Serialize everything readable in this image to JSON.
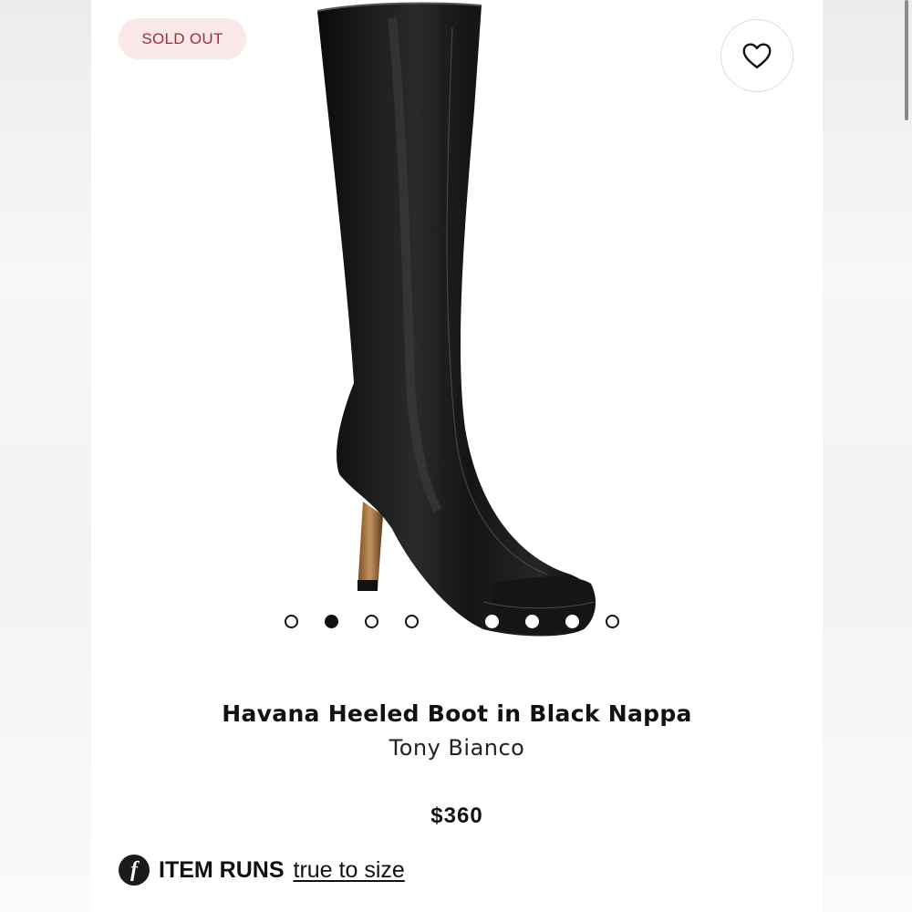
{
  "badge": {
    "label": "SOLD OUT"
  },
  "favorite": {
    "icon": "heart-icon"
  },
  "product": {
    "image_icon": "black-knee-high-boot-image",
    "title": "Havana Heeled Boot in Black Nappa",
    "brand": "Tony Bianco",
    "price": "$360"
  },
  "carousel": {
    "count": 9,
    "active_index": 1
  },
  "fit": {
    "icon_letter": "f",
    "label": "ITEM RUNS",
    "value": "true to size"
  },
  "colors": {
    "badge_bg": "#f8e8e8",
    "badge_text": "#9b2f36",
    "text": "#111111"
  }
}
